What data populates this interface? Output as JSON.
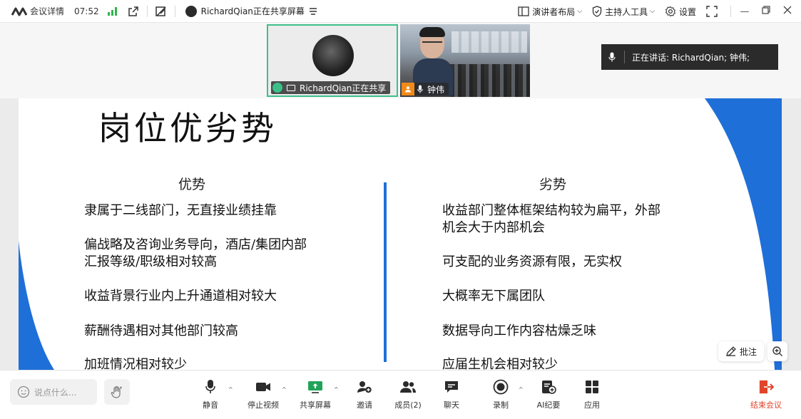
{
  "topbar": {
    "meeting_details": "会议详情",
    "time": "07:52",
    "sharer_title": "RichardQian正在共享屏幕",
    "presenter_layout": "演讲者布局",
    "host_tools": "主持人工具",
    "settings": "设置"
  },
  "videos": {
    "tile1_label": "RichardQian正在共享",
    "tile2_label": "钟伟"
  },
  "speaking": {
    "text": "正在讲话:  RichardQian; 钟伟;"
  },
  "slide": {
    "title": "岗位优劣势",
    "left_heading": "优势",
    "right_heading": "劣势",
    "advantages": [
      "隶属于二线部门，无直接业绩挂靠",
      "偏战略及咨询业务导向，酒店/集团内部",
      "汇报等级/职级相对较高",
      "收益背景行业内上升通道相对较大",
      "薪酬待遇相对其他部门较高",
      "加班情况相对较少"
    ],
    "disadvantages": [
      "收益部门整体框架结构较为扁平，外部",
      "机会大于内部机会",
      "可支配的业务资源有限，无实权",
      "大概率无下属团队",
      "数据导向工作内容枯燥乏味",
      "应届生机会相对较少"
    ],
    "accent_color": "#1f6fd8"
  },
  "floaters": {
    "annotate": "批注"
  },
  "toolbar": {
    "chat_placeholder": "说点什么...",
    "mute": "静音",
    "stop_video": "停止视频",
    "share_screen": "共享屏幕",
    "invite": "邀请",
    "members": "成员(2)",
    "chat": "聊天",
    "record": "录制",
    "ai_minutes": "AI纪要",
    "apps": "应用",
    "end_meeting": "结束会议",
    "end_color": "#e0442b"
  }
}
